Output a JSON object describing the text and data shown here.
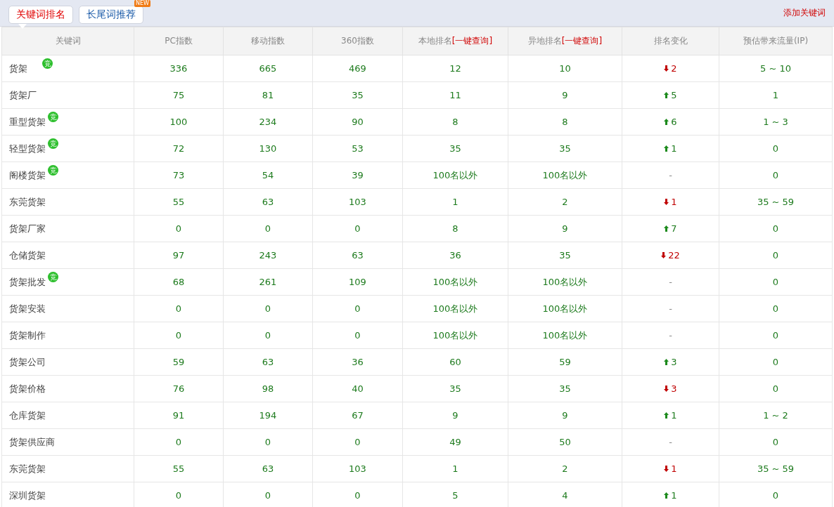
{
  "tabs": [
    {
      "label": "关键词排名",
      "selected": true
    },
    {
      "label": "长尾词推荐",
      "selected": false,
      "badge": "NEW"
    }
  ],
  "add_link": "添加关键词",
  "table": {
    "columns": [
      {
        "label": "关键词"
      },
      {
        "label": "PC指数"
      },
      {
        "label": "移动指数"
      },
      {
        "label": "360指数"
      },
      {
        "label": "本地排名",
        "link": "[一键查询]"
      },
      {
        "label": "异地排名",
        "link": "[一键查询]"
      },
      {
        "label": "排名变化"
      },
      {
        "label": "预估带来流量(IP)"
      }
    ],
    "rows": [
      {
        "keyword": "货架",
        "badge": "竞",
        "pc": "336",
        "mobile": "665",
        "s360": "469",
        "local": "12",
        "remote": "10",
        "change": {
          "kind": "down",
          "text": "2"
        },
        "traffic": "5 ~ 10"
      },
      {
        "keyword": "货架厂",
        "pc": "75",
        "mobile": "81",
        "s360": "35",
        "local": "11",
        "remote": "9",
        "change": {
          "kind": "up",
          "text": "5"
        },
        "traffic": "1"
      },
      {
        "keyword": "重型货架",
        "badge": "竞",
        "pc": "100",
        "mobile": "234",
        "s360": "90",
        "local": "8",
        "remote": "8",
        "change": {
          "kind": "up",
          "text": "6"
        },
        "traffic": "1 ~ 3"
      },
      {
        "keyword": "轻型货架",
        "badge": "竞",
        "pc": "72",
        "mobile": "130",
        "s360": "53",
        "local": "35",
        "remote": "35",
        "change": {
          "kind": "up",
          "text": "1"
        },
        "traffic": "0"
      },
      {
        "keyword": "阁楼货架",
        "badge": "竞",
        "pc": "73",
        "mobile": "54",
        "s360": "39",
        "local": "100名以外",
        "remote": "100名以外",
        "change": {
          "kind": "none",
          "text": "-"
        },
        "traffic": "0"
      },
      {
        "keyword": "东莞货架",
        "pc": "55",
        "mobile": "63",
        "s360": "103",
        "local": "1",
        "remote": "2",
        "change": {
          "kind": "down",
          "text": "1"
        },
        "traffic": "35 ~ 59"
      },
      {
        "keyword": "货架厂家",
        "pc": "0",
        "mobile": "0",
        "s360": "0",
        "local": "8",
        "remote": "9",
        "change": {
          "kind": "up",
          "text": "7"
        },
        "traffic": "0"
      },
      {
        "keyword": "仓储货架",
        "pc": "97",
        "mobile": "243",
        "s360": "63",
        "local": "36",
        "remote": "35",
        "change": {
          "kind": "down",
          "text": "22"
        },
        "traffic": "0"
      },
      {
        "keyword": "货架批发",
        "badge": "竞",
        "pc": "68",
        "mobile": "261",
        "s360": "109",
        "local": "100名以外",
        "remote": "100名以外",
        "change": {
          "kind": "none",
          "text": "-"
        },
        "traffic": "0"
      },
      {
        "keyword": "货架安装",
        "pc": "0",
        "mobile": "0",
        "s360": "0",
        "local": "100名以外",
        "remote": "100名以外",
        "change": {
          "kind": "none",
          "text": "-"
        },
        "traffic": "0"
      },
      {
        "keyword": "货架制作",
        "pc": "0",
        "mobile": "0",
        "s360": "0",
        "local": "100名以外",
        "remote": "100名以外",
        "change": {
          "kind": "none",
          "text": "-"
        },
        "traffic": "0"
      },
      {
        "keyword": "货架公司",
        "pc": "59",
        "mobile": "63",
        "s360": "36",
        "local": "60",
        "remote": "59",
        "change": {
          "kind": "up",
          "text": "3"
        },
        "traffic": "0"
      },
      {
        "keyword": "货架价格",
        "pc": "76",
        "mobile": "98",
        "s360": "40",
        "local": "35",
        "remote": "35",
        "change": {
          "kind": "down",
          "text": "3"
        },
        "traffic": "0"
      },
      {
        "keyword": "仓库货架",
        "pc": "91",
        "mobile": "194",
        "s360": "67",
        "local": "9",
        "remote": "9",
        "change": {
          "kind": "up",
          "text": "1"
        },
        "traffic": "1 ~ 2"
      },
      {
        "keyword": "货架供应商",
        "pc": "0",
        "mobile": "0",
        "s360": "0",
        "local": "49",
        "remote": "50",
        "change": {
          "kind": "none",
          "text": "-"
        },
        "traffic": "0"
      },
      {
        "keyword": "东莞货架",
        "pc": "55",
        "mobile": "63",
        "s360": "103",
        "local": "1",
        "remote": "2",
        "change": {
          "kind": "down",
          "text": "1"
        },
        "traffic": "35 ~ 59"
      },
      {
        "keyword": "深圳货架",
        "pc": "0",
        "mobile": "0",
        "s360": "0",
        "local": "5",
        "remote": "4",
        "change": {
          "kind": "up",
          "text": "1"
        },
        "traffic": "0"
      }
    ]
  }
}
